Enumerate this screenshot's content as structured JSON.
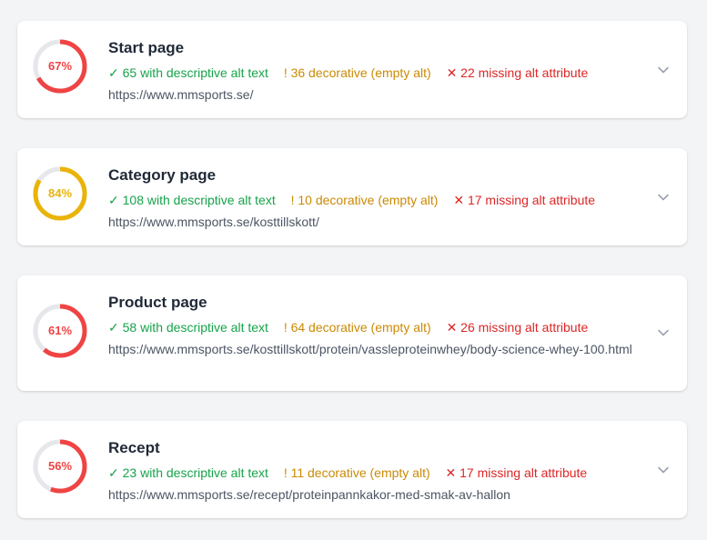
{
  "colors": {
    "track": "#e5e7eb",
    "red": "#ef4444",
    "yellow": "#eab308",
    "good": "#16a34a",
    "warn": "#ca8a04",
    "bad": "#dc2626",
    "chevron": "#9ca3af"
  },
  "pages": [
    {
      "title": "Start page",
      "percent": 67,
      "percent_label": "67%",
      "ring_color": "#ef4444",
      "descriptive": "✓ 65 with descriptive alt text",
      "decorative": "! 36 decorative (empty alt)",
      "missing": "✕ 22 missing alt attribute",
      "url": "https://www.mmsports.se/",
      "chevron_icon": "chevron-down-icon"
    },
    {
      "title": "Category page",
      "percent": 84,
      "percent_label": "84%",
      "ring_color": "#eab308",
      "descriptive": "✓ 108 with descriptive alt text",
      "decorative": "! 10 decorative (empty alt)",
      "missing": "✕ 17 missing alt attribute",
      "url": "https://www.mmsports.se/kosttillskott/",
      "chevron_icon": "chevron-down-icon"
    },
    {
      "title": "Product page",
      "percent": 61,
      "percent_label": "61%",
      "ring_color": "#ef4444",
      "descriptive": "✓ 58 with descriptive alt text",
      "decorative": "! 64 decorative (empty alt)",
      "missing": "✕ 26 missing alt attribute",
      "url": "https://www.mmsports.se/kosttillskott/protein/vassleproteinwhey/body-science-whey-100.html",
      "chevron_icon": "chevron-down-icon"
    },
    {
      "title": "Recept",
      "percent": 56,
      "percent_label": "56%",
      "ring_color": "#ef4444",
      "descriptive": "✓ 23 with descriptive alt text",
      "decorative": "! 11 decorative (empty alt)",
      "missing": "✕ 17 missing alt attribute",
      "url": "https://www.mmsports.se/recept/proteinpannkakor-med-smak-av-hallon",
      "chevron_icon": "chevron-down-icon"
    }
  ]
}
